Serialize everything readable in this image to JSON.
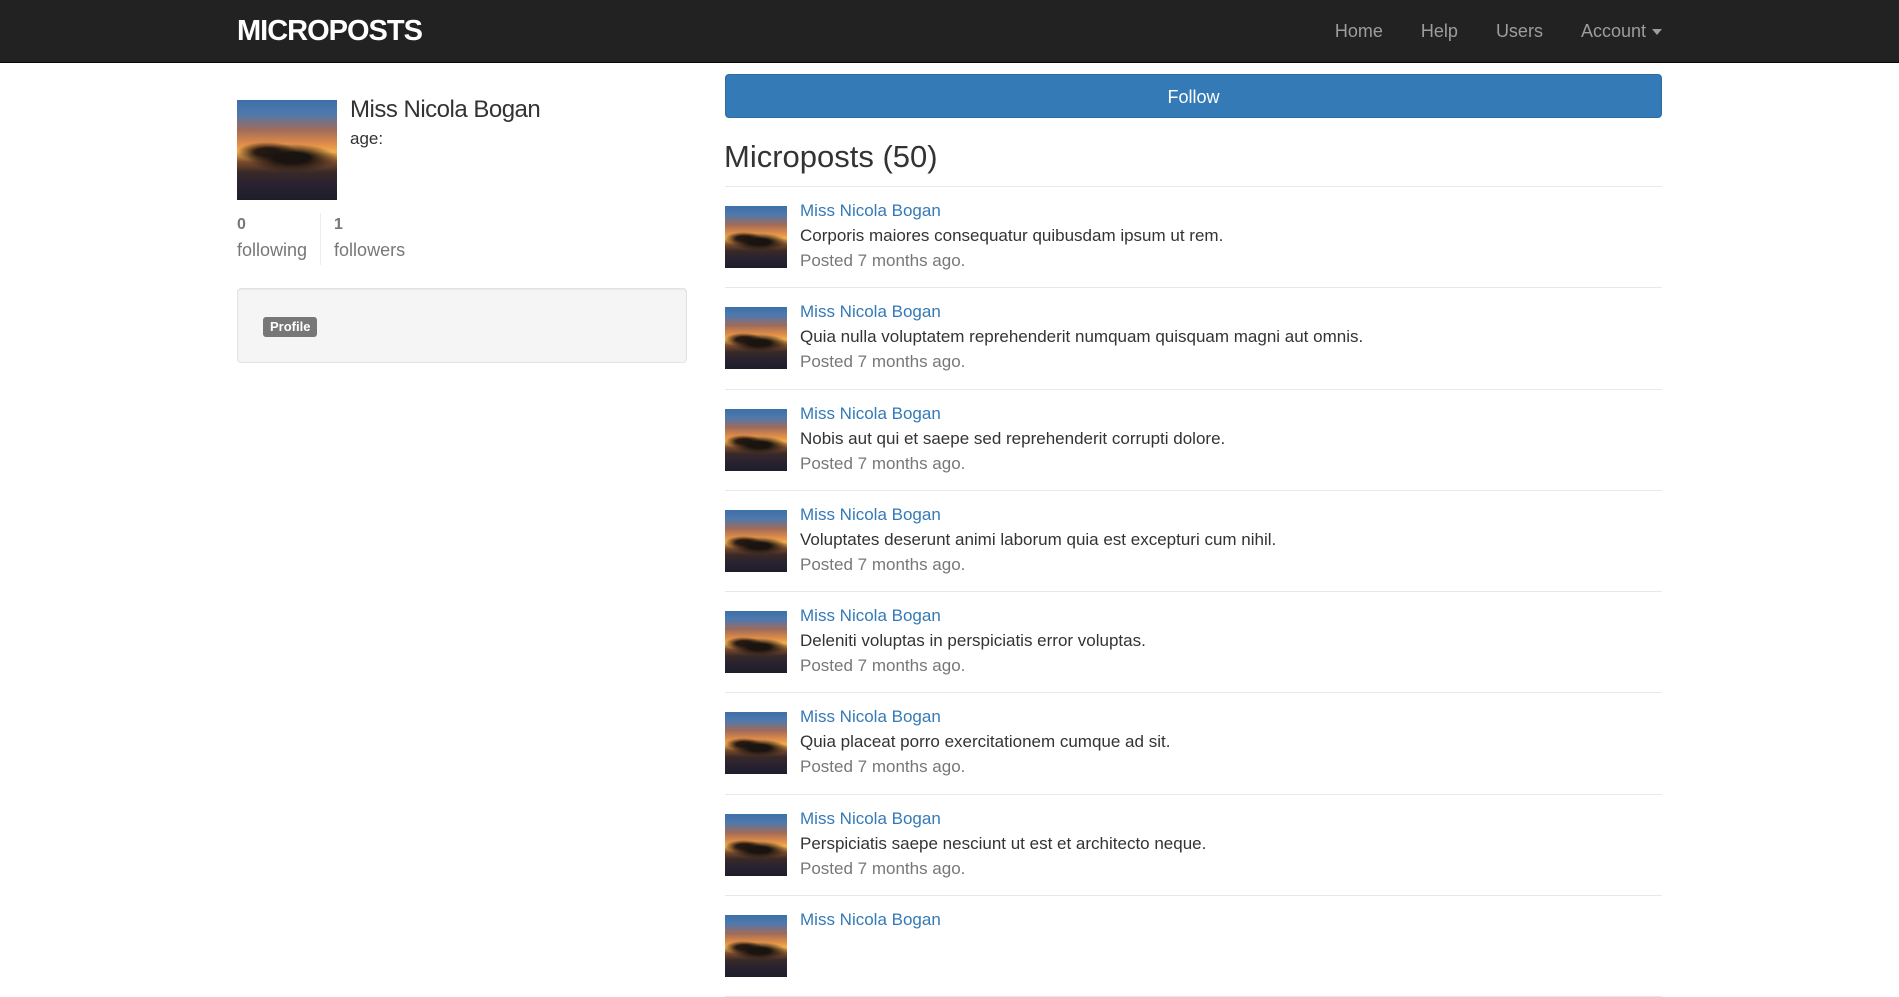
{
  "navbar": {
    "brand": "MICROPOSTS",
    "links": [
      "Home",
      "Help",
      "Users"
    ],
    "account_label": "Account"
  },
  "profile": {
    "name": "Miss Nicola Bogan",
    "age_label": "age:",
    "following_count": "0",
    "following_label": "following",
    "followers_count": "1",
    "followers_label": "followers",
    "badge_label": "Profile",
    "avatar_image": "sunset-photo"
  },
  "main": {
    "follow_label": "Follow",
    "heading": "Microposts (50)"
  },
  "feed": [
    {
      "user": "Miss Nicola Bogan",
      "content": "Corporis maiores consequatur quibusdam ipsum ut rem.",
      "time": "Posted 7 months ago."
    },
    {
      "user": "Miss Nicola Bogan",
      "content": "Quia nulla voluptatem reprehenderit numquam quisquam magni aut omnis.",
      "time": "Posted 7 months ago."
    },
    {
      "user": "Miss Nicola Bogan",
      "content": "Nobis aut qui et saepe sed reprehenderit corrupti dolore.",
      "time": "Posted 7 months ago."
    },
    {
      "user": "Miss Nicola Bogan",
      "content": "Voluptates deserunt animi laborum quia est excepturi cum nihil.",
      "time": "Posted 7 months ago."
    },
    {
      "user": "Miss Nicola Bogan",
      "content": "Deleniti voluptas in perspiciatis error voluptas.",
      "time": "Posted 7 months ago."
    },
    {
      "user": "Miss Nicola Bogan",
      "content": "Quia placeat porro exercitationem cumque ad sit.",
      "time": "Posted 7 months ago."
    },
    {
      "user": "Miss Nicola Bogan",
      "content": "Perspiciatis saepe nesciunt ut est et architecto neque.",
      "time": "Posted 7 months ago."
    },
    {
      "user": "Miss Nicola Bogan",
      "content": "",
      "time": ""
    }
  ],
  "colors": {
    "navbar_bg": "#222222",
    "brand": "#ffffff",
    "nav_link": "#9d9d9d",
    "primary": "#337ab7",
    "muted": "#777777"
  }
}
